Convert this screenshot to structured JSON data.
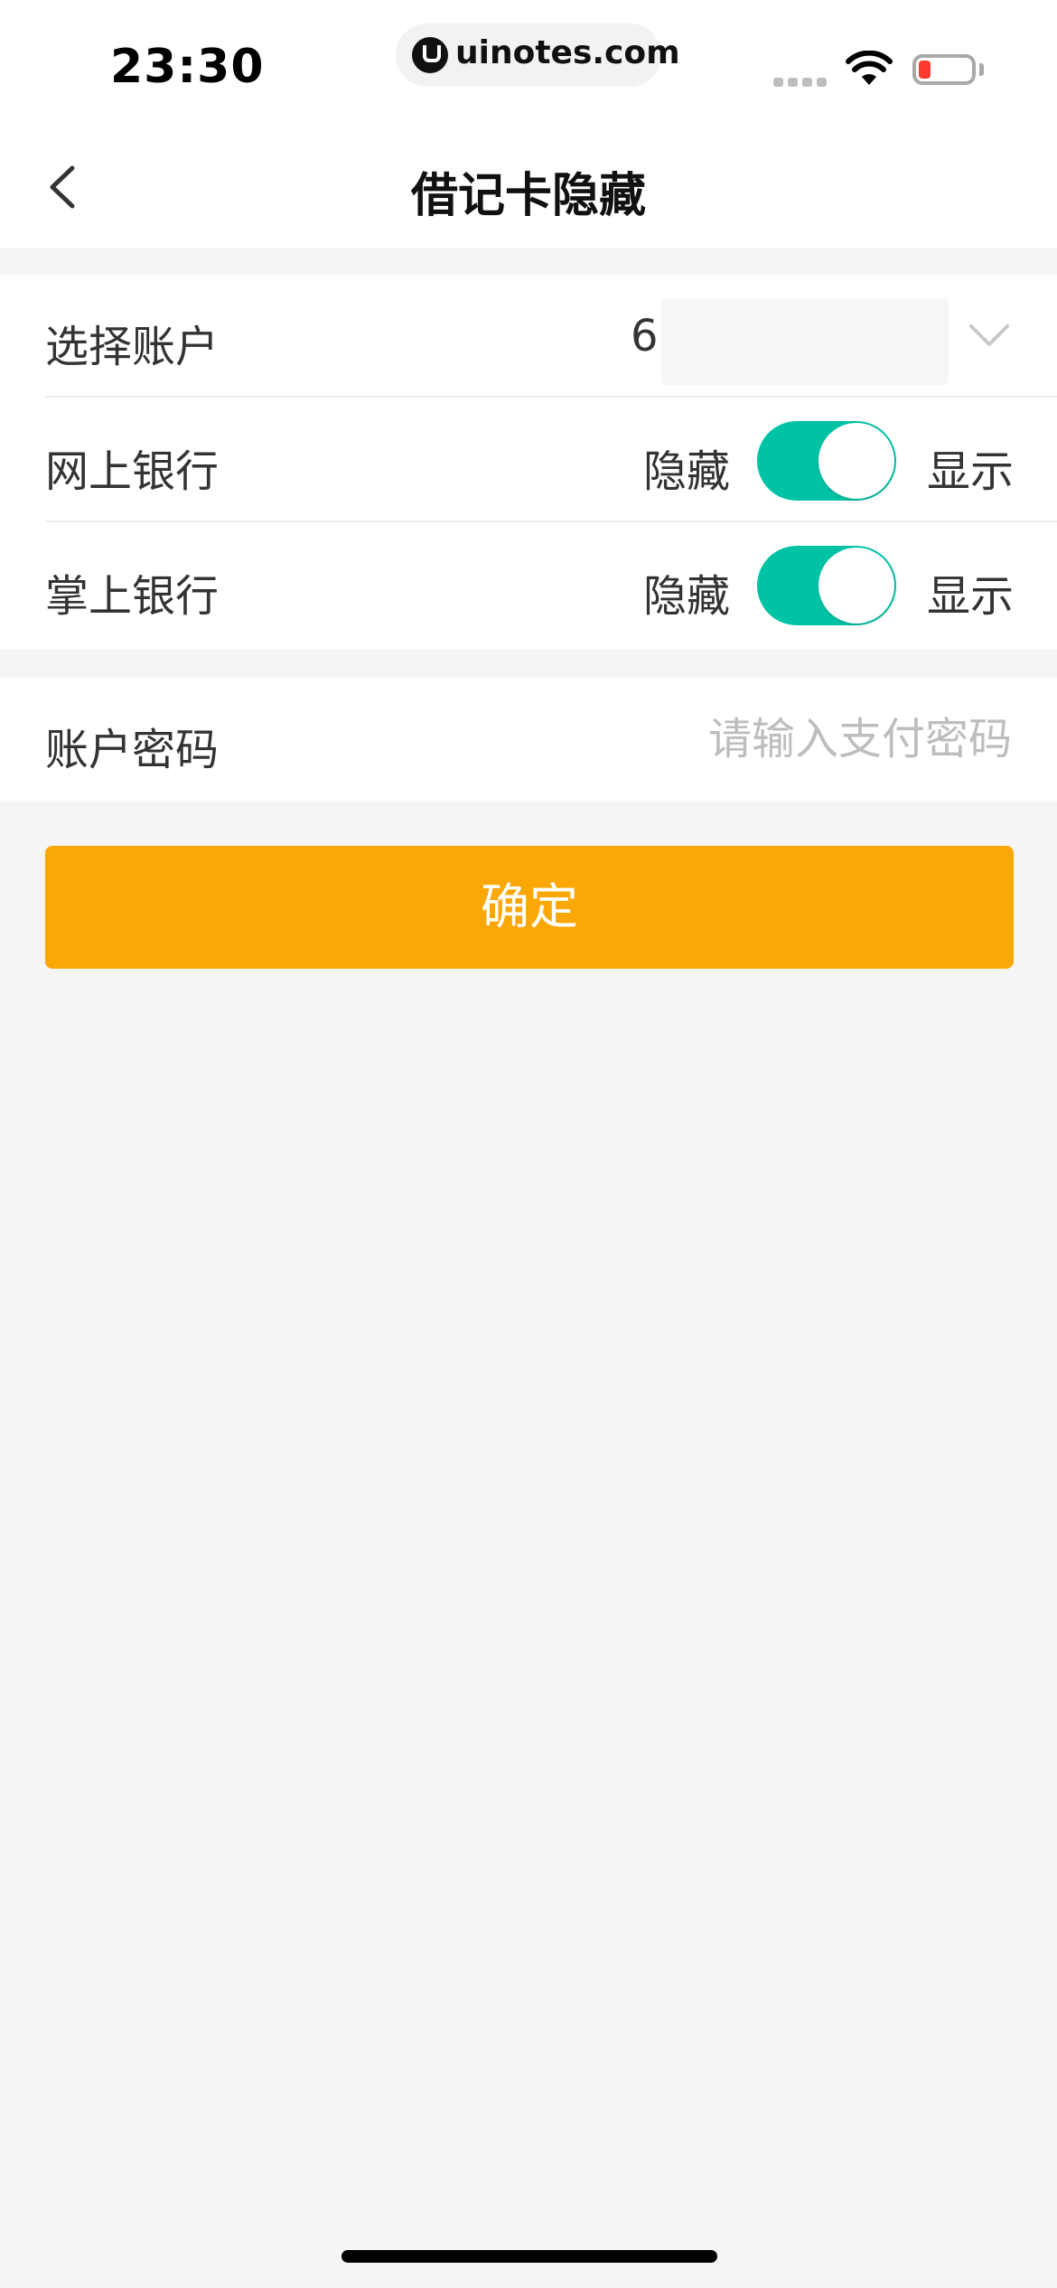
{
  "status_bar": {
    "time": "23:30",
    "url": "uinotes.com",
    "battery_color": "#ff3b30"
  },
  "nav": {
    "title": "借记卡隐藏",
    "back_icon": "chevron-left-icon"
  },
  "account_row": {
    "label": "选择账户",
    "value": "6",
    "dropdown_icon": "chevron-down-icon"
  },
  "online_banking_row": {
    "label": "网上银行",
    "off_label": "隐藏",
    "on_label": "显示",
    "toggle_on": true
  },
  "mobile_banking_row": {
    "label": "掌上银行",
    "off_label": "隐藏",
    "on_label": "显示",
    "toggle_on": true
  },
  "password_row": {
    "label": "账户密码",
    "placeholder": "请输入支付密码",
    "value": ""
  },
  "confirm_button": {
    "label": "确定"
  },
  "colors": {
    "accent": "#fba705",
    "toggle_on": "#00c3a5",
    "background": "#f5f5f5",
    "card": "#ffffff",
    "placeholder": "#bdbdbd"
  }
}
